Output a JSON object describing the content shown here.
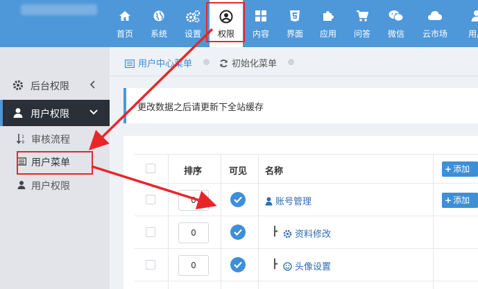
{
  "nav": {
    "items": [
      {
        "label": "首页",
        "icon": "home-icon"
      },
      {
        "label": "系统",
        "icon": "globe-icon"
      },
      {
        "label": "设置",
        "icon": "gears-icon"
      },
      {
        "label": "权限",
        "icon": "user-circle-icon"
      },
      {
        "label": "内容",
        "icon": "grid-icon"
      },
      {
        "label": "界面",
        "icon": "html5-icon"
      },
      {
        "label": "应用",
        "icon": "puzzle-icon"
      },
      {
        "label": "问答",
        "icon": "cart-icon"
      },
      {
        "label": "微信",
        "icon": "wechat-icon"
      },
      {
        "label": "云市场",
        "icon": "cloud-icon"
      },
      {
        "label": "用户",
        "icon": "user-icon"
      }
    ],
    "active": "权限"
  },
  "sidebar": {
    "groups": [
      {
        "label": "后台权限",
        "icon": "gear-icon",
        "caret": "chevron-left-icon"
      },
      {
        "label": "用户权限",
        "icon": "user-icon",
        "caret": "chevron-down-icon"
      }
    ],
    "sub_items": [
      {
        "label": "审核流程",
        "icon": "sort-numeric-icon"
      },
      {
        "label": "用户菜单",
        "icon": "list-icon"
      },
      {
        "label": "用户权限",
        "icon": "user-icon"
      }
    ],
    "active_sub": "用户菜单"
  },
  "breadcrumb": {
    "items": [
      {
        "label": "用户中心菜单",
        "icon": "list-icon"
      },
      {
        "label": "初始化菜单",
        "icon": "refresh-icon"
      }
    ]
  },
  "notice": {
    "text": "更改数据之后请更新下全站缓存"
  },
  "table": {
    "headers": {
      "order": "排序",
      "visible": "可见",
      "name": "名称"
    },
    "add_label": "添加",
    "rows": [
      {
        "order": "0",
        "name": "账号管理",
        "icon": "user-icon",
        "level": 0
      },
      {
        "order": "0",
        "name": "资料修改",
        "icon": "gear-icon",
        "level": 1
      },
      {
        "order": "0",
        "name": "头像设置",
        "icon": "smile-icon",
        "level": 1
      }
    ]
  },
  "colors": {
    "primary": "#4e97d9",
    "dark_sidebar": "#2a2f38",
    "annotation_red": "#e8262a"
  }
}
